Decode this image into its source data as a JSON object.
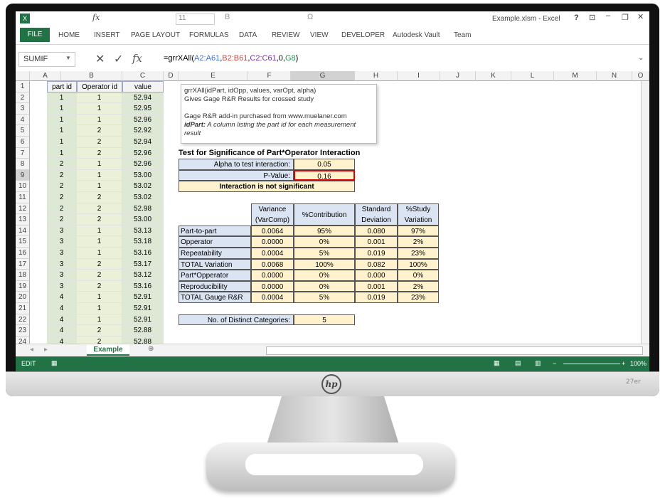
{
  "window": {
    "title": "Example.xlsm - Excel",
    "help": "?"
  },
  "ribbon_tabs": [
    "FILE",
    "HOME",
    "INSERT",
    "PAGE LAYOUT",
    "FORMULAS",
    "DATA",
    "REVIEW",
    "VIEW",
    "DEVELOPER",
    "Autodesk Vault",
    "Team"
  ],
  "font_size": "11",
  "name_box": "SUMIF",
  "formula": {
    "prefix": "=grrXAll(",
    "r1": "A2:A61",
    "c1": ",",
    "r2": "B2:B61",
    "c2": ",",
    "r3": "C2:C61",
    "tail": ",0,",
    "r4": "G8",
    "end": ")"
  },
  "tooltip": {
    "sig": "grrXAll(idPart, idOpp, values, varOpt, alpha)",
    "desc": "Gives Gage R&R Results for crossed study",
    "line3": "Gage R&R add-in purchased from www.muelaner.com",
    "arg": "idPart:",
    "argdesc": "A column listing the part id for each measurement result"
  },
  "columns": [
    "A",
    "B",
    "C",
    "D",
    "E",
    "F",
    "G",
    "H",
    "I",
    "J",
    "K",
    "L",
    "M",
    "N",
    "O"
  ],
  "headers": {
    "a": "part id",
    "b": "Operator id",
    "c": "value"
  },
  "rows": [
    [
      "1",
      "1",
      "52.94"
    ],
    [
      "1",
      "1",
      "52.95"
    ],
    [
      "1",
      "1",
      "52.96"
    ],
    [
      "1",
      "2",
      "52.92"
    ],
    [
      "1",
      "2",
      "52.94"
    ],
    [
      "1",
      "2",
      "52.96"
    ],
    [
      "2",
      "1",
      "52.96"
    ],
    [
      "2",
      "1",
      "53.00"
    ],
    [
      "2",
      "1",
      "53.02"
    ],
    [
      "2",
      "2",
      "53.02"
    ],
    [
      "2",
      "2",
      "52.98"
    ],
    [
      "2",
      "2",
      "53.00"
    ],
    [
      "3",
      "1",
      "53.13"
    ],
    [
      "3",
      "1",
      "53.18"
    ],
    [
      "3",
      "1",
      "53.16"
    ],
    [
      "3",
      "2",
      "53.17"
    ],
    [
      "3",
      "2",
      "53.12"
    ],
    [
      "3",
      "2",
      "53.16"
    ],
    [
      "4",
      "1",
      "52.91"
    ],
    [
      "4",
      "1",
      "52.91"
    ],
    [
      "4",
      "1",
      "52.91"
    ],
    [
      "4",
      "2",
      "52.88"
    ],
    [
      "4",
      "2",
      "52.88"
    ]
  ],
  "sig": {
    "title": "Test for Significance of Part*Operator Interaction",
    "alpha_label": "Alpha to test interaction:",
    "alpha": "0.05",
    "p_label": "P-Value:",
    "p": "0.16",
    "result": "Interaction is not significant"
  },
  "table": {
    "h1a": "Variance",
    "h1b": "(VarComp)",
    "h2": "%Contribution",
    "h3a": "Standard",
    "h3b": "Deviation",
    "h4a": "%Study",
    "h4b": "Variation",
    "rows": [
      [
        "Part-to-part",
        "0.0064",
        "95%",
        "0.080",
        "97%"
      ],
      [
        "Opperator",
        "0.0000",
        "0%",
        "0.001",
        "2%"
      ],
      [
        "Repeatability",
        "0.0004",
        "5%",
        "0.019",
        "23%"
      ],
      [
        "TOTAL Variation",
        "0.0068",
        "100%",
        "0.082",
        "100%"
      ],
      [
        "Part*Opperator",
        "0.0000",
        "0%",
        "0.000",
        "0%"
      ],
      [
        "Reproducibility",
        "0.0000",
        "0%",
        "0.001",
        "2%"
      ],
      [
        "TOTAL Gauge R&R",
        "0.0004",
        "5%",
        "0.019",
        "23%"
      ]
    ]
  },
  "ndc": {
    "label": "No. of Distinct Categories:",
    "value": "5"
  },
  "sheet_tab": "Example",
  "status": {
    "mode": "EDIT",
    "zoom": "100%"
  },
  "monitor": {
    "brand": "hp",
    "model": "27er"
  }
}
